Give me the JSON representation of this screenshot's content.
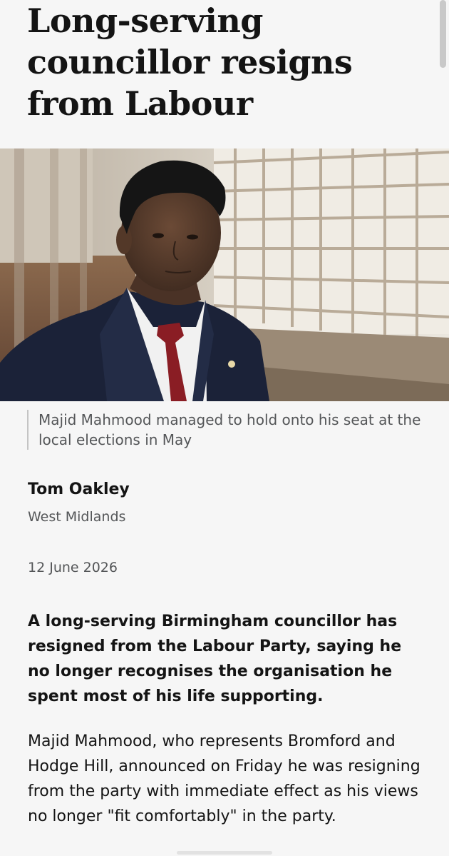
{
  "article": {
    "headline": "Long-serving councillor resigns from Labour",
    "image": {
      "caption": "Majid Mahmood managed to hold onto his seat at the local elections in May"
    },
    "byline": {
      "name": "Tom Oakley",
      "role": "West Midlands"
    },
    "date": "12 June 2026",
    "lead": "A long-serving Birmingham councillor has resigned from the Labour Party, saying he no longer recognises the organisation he spent most of his life supporting.",
    "paragraphs": [
      "Majid Mahmood, who represents Bromford and Hodge Hill, announced on Friday he was resigning from the party with immediate effect as his views no longer \"fit comfortably\" in the party."
    ]
  },
  "colors": {
    "background": "#f6f6f6",
    "text": "#141414",
    "muted_text": "#545658",
    "caption_rule": "#c4c4c4"
  }
}
